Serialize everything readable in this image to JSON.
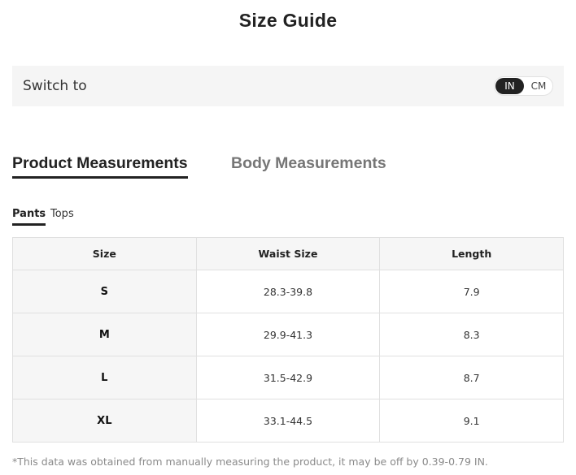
{
  "title": "Size Guide",
  "switch": {
    "label": "Switch to",
    "options": [
      "IN",
      "CM"
    ],
    "selected": "IN"
  },
  "measurement_tabs": {
    "product": "Product Measurements",
    "body": "Body Measurements",
    "active": "Product Measurements"
  },
  "category_tabs": {
    "pants": "Pants",
    "tops": "Tops",
    "active": "Pants"
  },
  "table": {
    "headers": [
      "Size",
      "Waist Size",
      "Length"
    ],
    "rows": [
      [
        "S",
        "28.3-39.8",
        "7.9"
      ],
      [
        "M",
        "29.9-41.3",
        "8.3"
      ],
      [
        "L",
        "31.5-42.9",
        "8.7"
      ],
      [
        "XL",
        "33.1-44.5",
        "9.1"
      ]
    ]
  },
  "footnote": "*This data was obtained from manually measuring the product, it may be off by 0.39-0.79 IN.",
  "colors": {
    "accent": "#222222",
    "panel_bg": "#f5f5f5",
    "inactive_tab": "#767676",
    "footnote": "#8a8a8a"
  }
}
